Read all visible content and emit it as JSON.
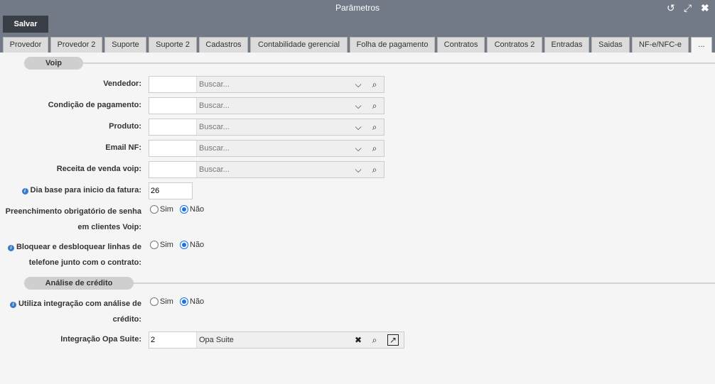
{
  "window": {
    "title": "Parâmetros"
  },
  "toolbar": {
    "save_label": "Salvar"
  },
  "tabs": [
    {
      "label": "Provedor"
    },
    {
      "label": "Provedor 2"
    },
    {
      "label": "Suporte"
    },
    {
      "label": "Suporte 2"
    },
    {
      "label": "Cadastros"
    },
    {
      "label": "Contabilidade gerencial"
    },
    {
      "label": "Folha de pagamento"
    },
    {
      "label": "Contratos"
    },
    {
      "label": "Contratos 2"
    },
    {
      "label": "Entradas"
    },
    {
      "label": "Saidas"
    },
    {
      "label": "NF-e/NFC-e"
    },
    {
      "label": "..."
    }
  ],
  "sections": {
    "voip": "Voip",
    "credit": "Análise de crédito"
  },
  "icons": {
    "info": "i",
    "dropdown": "chevron-down-icon",
    "search": "search-icon",
    "clear": "close-icon",
    "open": "external-link-icon"
  },
  "fields": {
    "vendedor": {
      "label": "Vendedor:",
      "code": "",
      "placeholder": "Buscar..."
    },
    "condicao": {
      "label": "Condição de pagamento:",
      "code": "",
      "placeholder": "Buscar..."
    },
    "produto": {
      "label": "Produto:",
      "code": "",
      "placeholder": "Buscar..."
    },
    "email_nf": {
      "label": "Email NF:",
      "code": "",
      "placeholder": "Buscar..."
    },
    "receita": {
      "label": "Receita de venda voip:",
      "code": "",
      "placeholder": "Buscar..."
    },
    "dia_base": {
      "label": "Dia base para inicio da fatura:",
      "value": "26"
    },
    "senha": {
      "label_line1": "Preenchimento obrigatório de senha",
      "label_line2": "em clientes Voip:",
      "yes": "Sim",
      "no": "Não",
      "selected": "no"
    },
    "bloquear": {
      "label_line1": "Bloquear e desbloquear linhas de",
      "label_line2": "telefone junto com o contrato:",
      "yes": "Sim",
      "no": "Não",
      "selected": "no"
    },
    "integracao_credito": {
      "label_line1": "Utiliza integração com análise de",
      "label_line2": "crédito:",
      "yes": "Sim",
      "no": "Não",
      "selected": "no"
    },
    "opa_suite": {
      "label": "Integração Opa Suite:",
      "code": "2",
      "desc": "Opa Suite"
    }
  }
}
